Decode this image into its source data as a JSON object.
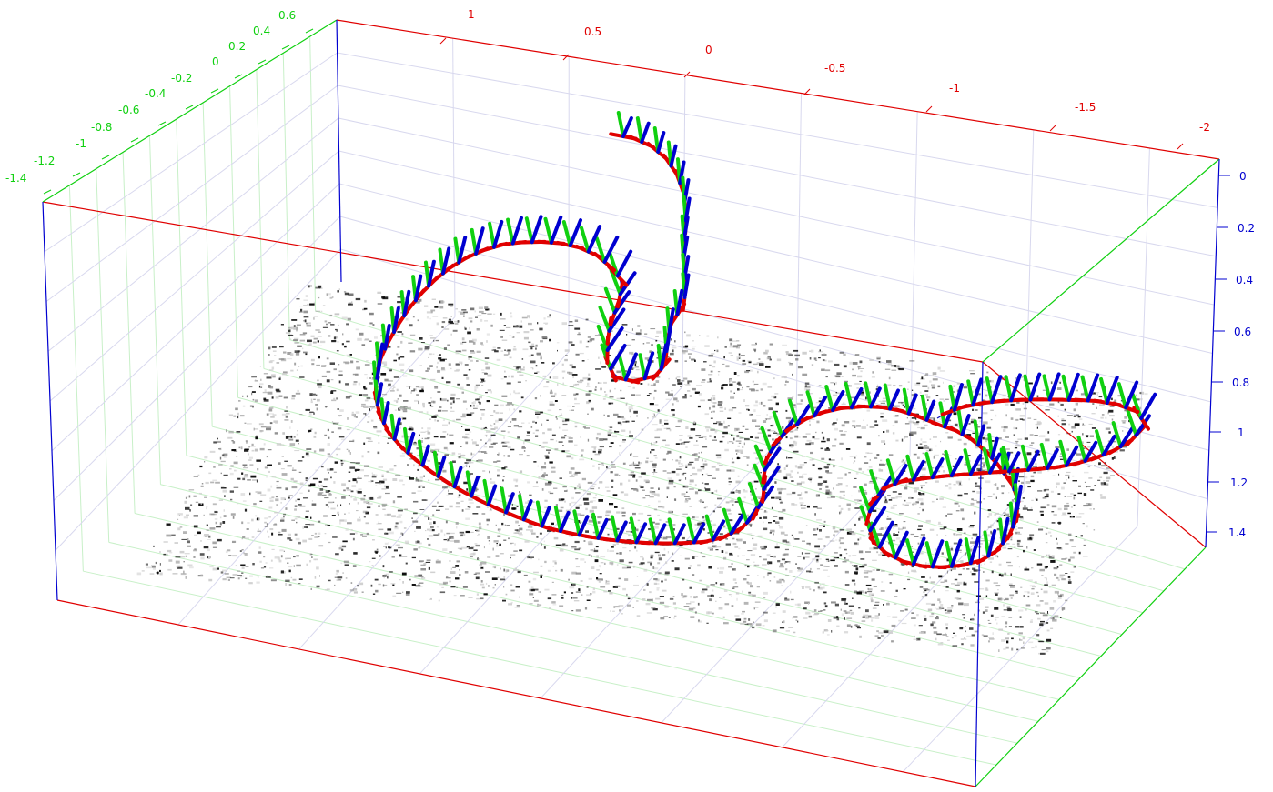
{
  "chart_data": {
    "type": "scatter",
    "title": "",
    "axes": {
      "x": {
        "color": "#e00000",
        "ticks": [
          "1",
          "0.5",
          "0",
          "-0.5",
          "-1",
          "-1.5",
          "-2"
        ]
      },
      "y": {
        "color": "#10d010",
        "ticks": [
          "0.6",
          "0.4",
          "0.2",
          "0",
          "-0.2",
          "-0.4",
          "-0.6",
          "-0.8",
          "-1",
          "-1.2",
          "-1.4"
        ]
      },
      "z": {
        "color": "#0000d0",
        "ticks": [
          "0",
          "0.2",
          "0.4",
          "0.6",
          "0.8",
          "1",
          "1.2",
          "1.4"
        ]
      }
    },
    "grid": true,
    "point_cloud": {
      "color": "#222222",
      "description_colors": [
        "#000000",
        "#888888",
        "#cccccc"
      ]
    },
    "trajectory": {
      "line_color": "#1010c0",
      "frame_axis_colors": {
        "x": "#e00000",
        "y": "#10d010",
        "z": "#0000d0"
      }
    }
  }
}
